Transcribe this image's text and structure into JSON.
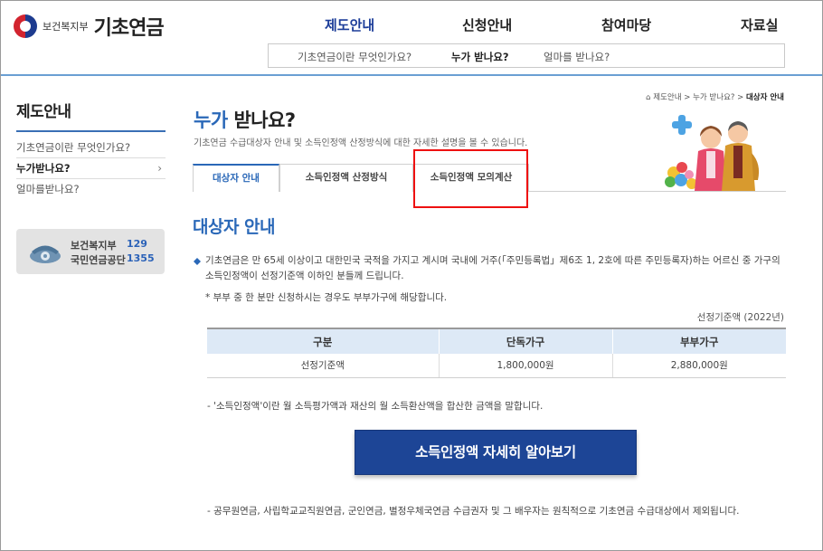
{
  "header": {
    "ministry": "보건복지부",
    "site_title": "기초연금",
    "gnb": [
      "제도안내",
      "신청안내",
      "참여마당",
      "자료실"
    ],
    "subnav": [
      "기초연금이란 무엇인가요?",
      "누가 받나요?",
      "얼마를 받나요?"
    ]
  },
  "sidebar": {
    "title": "제도안내",
    "items": [
      {
        "label": "기초연금이란 무엇인가요?"
      },
      {
        "label": "누가받나요?",
        "chevron": "›"
      },
      {
        "label": "얼마를받나요?"
      }
    ],
    "contact": {
      "org1": "보건복지부",
      "num1": "129",
      "org2": "국민연금공단",
      "num2": "1355"
    }
  },
  "breadcrumb": {
    "path": "제도안내 > 누가 받나요? > ",
    "current": "대상자 안내"
  },
  "page": {
    "title_highlight": "누가",
    "title_rest": " 받나요?",
    "description": "기초연금 수급대상자 안내 및 소득인정액 산정방식에 대한 자세한 설명을 볼 수 있습니다."
  },
  "tabs": [
    "대상자 안내",
    "소득인정액 산정방식",
    "소득인정액 모의계산"
  ],
  "section": {
    "title": "대상자 안내",
    "paragraph": "기초연금은 만 65세 이상이고 대한민국 국적을 가지고 계시며 국내에 거주(「주민등록법」제6조 1, 2호에 따른 주민등록자)하는 어르신 중 가구의 소득인정액이 선정기준액 이하인 분들께 드립니다.",
    "note1": "* 부부 중 한 분만 신청하시는 경우도 부부가구에 해당합니다.",
    "table_caption": "선정기준액 (2022년)",
    "table": {
      "headers": [
        "구분",
        "단독가구",
        "부부가구"
      ],
      "row": [
        "선정기준액",
        "1,800,000원",
        "2,880,000원"
      ]
    },
    "note2": "- '소득인정액'이란 월 소득평가액과 재산의 월 소득환산액을 합산한 금액을 말합니다.",
    "cta_label": "소득인정액 자세히 알아보기",
    "note3": "- 공무원연금, 사립학교교직원연금, 군인연금, 별정우체국연금 수급권자 및 그 배우자는 원칙적으로 기초연금 수급대상에서 제외됩니다."
  },
  "colors": {
    "accent": "#2a68b8",
    "cta": "#1d4596",
    "table_header": "#dde9f6",
    "highlight_box": "#e11111"
  }
}
